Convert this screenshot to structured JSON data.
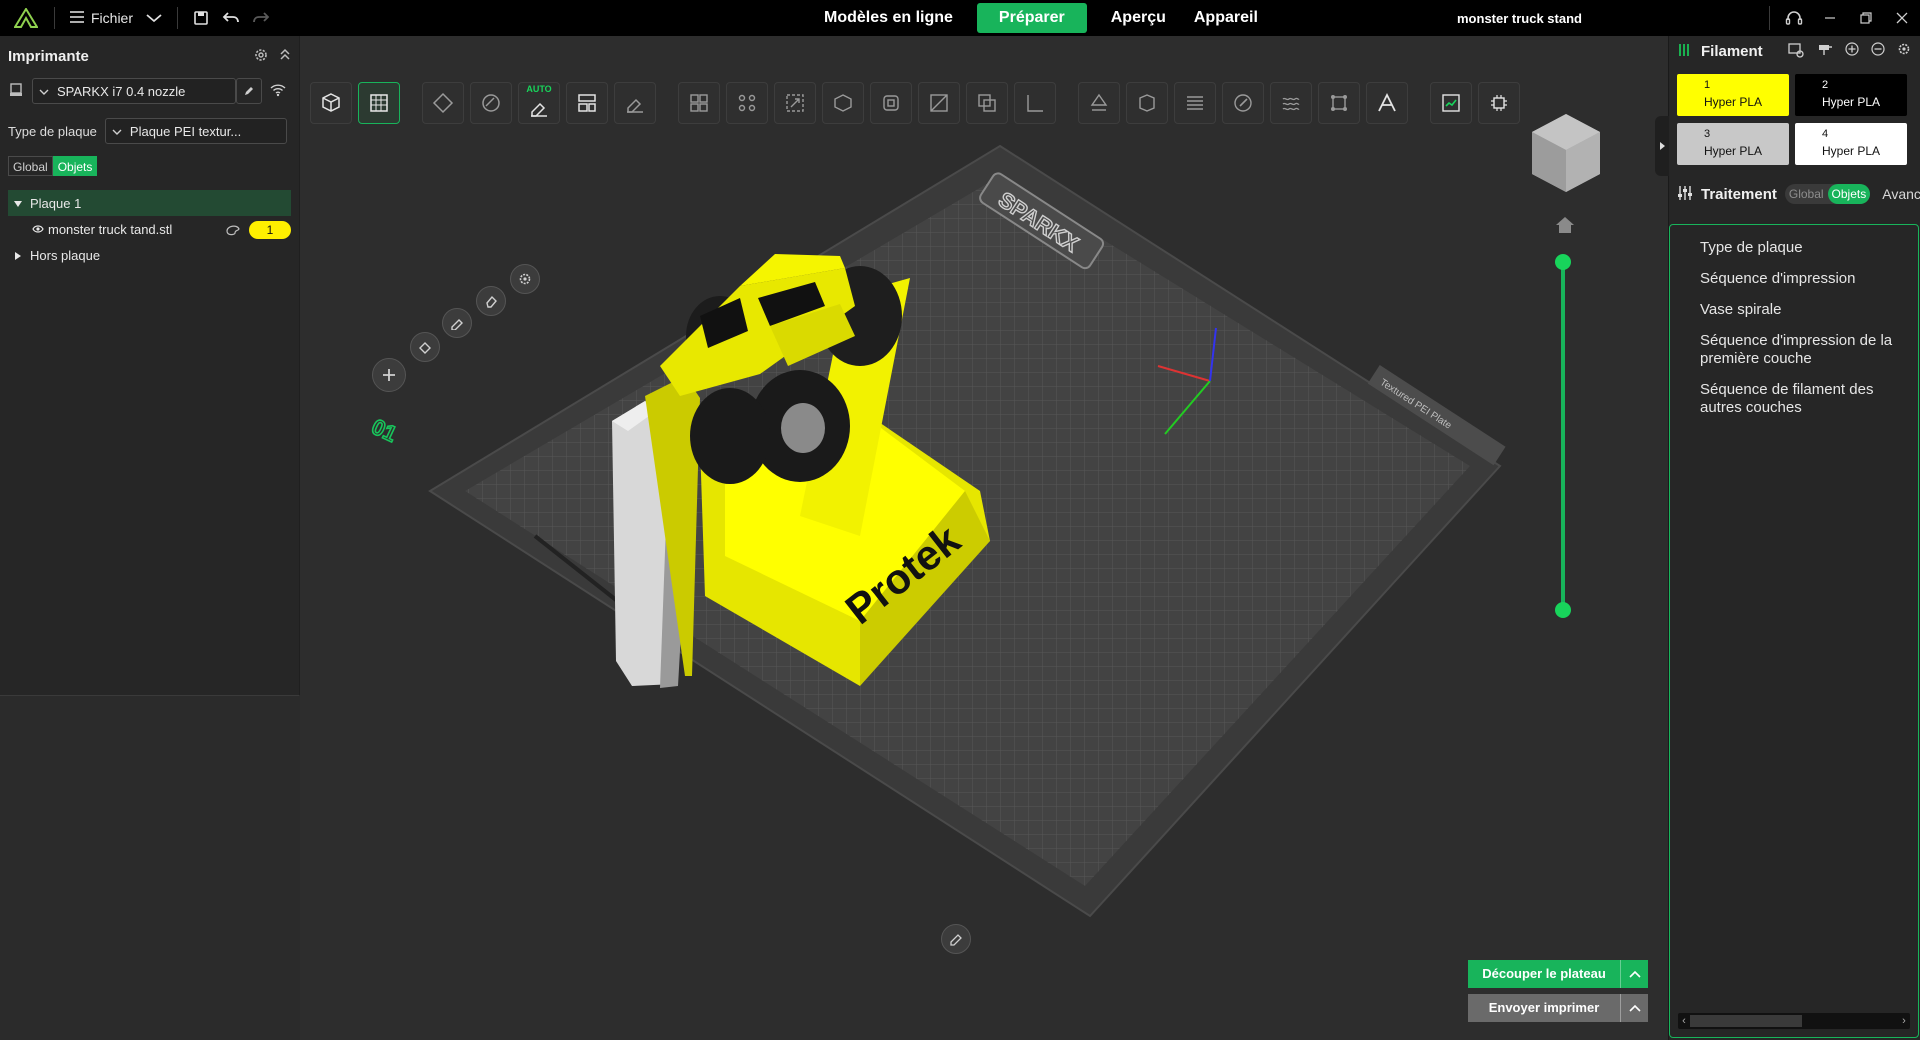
{
  "topbar": {
    "file_label": "Fichier",
    "tabs": [
      {
        "label": "Modèles en ligne"
      },
      {
        "label": "Préparer"
      },
      {
        "label": "Aperçu"
      },
      {
        "label": "Appareil"
      }
    ],
    "active_tab": "Préparer",
    "project_title": "monster truck stand"
  },
  "left_panel": {
    "title": "Imprimante",
    "printer_name": "SPARKX i7 0.4 nozzle",
    "plate_type_label": "Type de plaque",
    "plate_type_value": "Plaque PEI textur...",
    "seg": {
      "global": "Global",
      "objects": "Objets"
    },
    "tree": {
      "plate": "Plaque 1",
      "object": "monster truck tand.stl",
      "object_filament": "1",
      "offplate": "Hors plaque"
    }
  },
  "viewport": {
    "toolbar_auto_label": "AUTO",
    "plate_number": "01",
    "bed_brand": "SPARKX",
    "bed_plate_label": "Textured PEI Plate",
    "object_text": "Protek",
    "colors": {
      "object": "#ffff00",
      "bed": "#3f3f3f",
      "accent": "#18b45b"
    },
    "slice_button": "Découper le plateau",
    "print_button": "Envoyer imprimer"
  },
  "right_panel": {
    "filament_title": "Filament",
    "filaments": [
      {
        "num": "1",
        "name": "Hyper PLA",
        "color": "#ffff00",
        "text": "#111111"
      },
      {
        "num": "2",
        "name": "Hyper PLA",
        "color": "#000000",
        "text": "#ffffff"
      },
      {
        "num": "3",
        "name": "Hyper PLA",
        "color": "#c8c8c8",
        "text": "#111111"
      },
      {
        "num": "4",
        "name": "Hyper PLA",
        "color": "#ffffff",
        "text": "#111111"
      }
    ],
    "process_title": "Traitement",
    "seg": {
      "global": "Global",
      "objects": "Objets"
    },
    "advanced_label": "Avancé",
    "settings": [
      "Type de plaque",
      "Séquence d'impression",
      "Vase spirale",
      "Séquence d'impression de la première couche",
      "Séquence de filament des autres couches"
    ]
  }
}
